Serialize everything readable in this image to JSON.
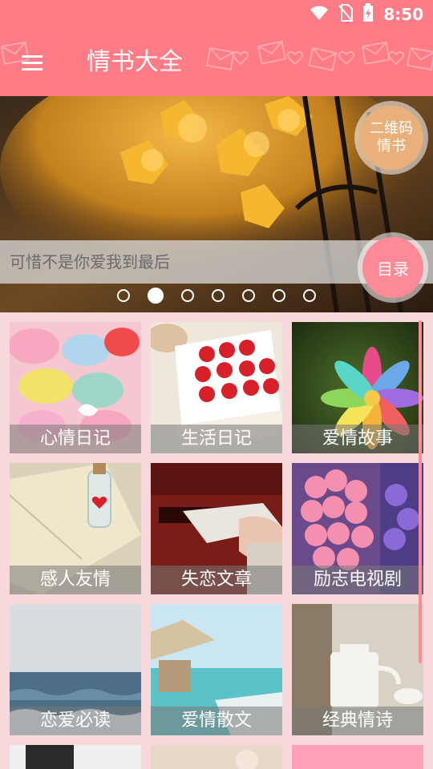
{
  "status_bar": {
    "time": "8:50",
    "icons": [
      "wifi-icon",
      "no-sim-icon",
      "battery-charging-icon"
    ]
  },
  "app_bar": {
    "title": "情书大全",
    "menu_icon": "menu-icon"
  },
  "banner": {
    "caption": "可惜不是你爱我到最后",
    "qr_button": "二维码\n情书",
    "qr_button_line1": "二维码",
    "qr_button_line2": "情书",
    "toc_button": "目录",
    "page_count": 7,
    "active_page": 2
  },
  "categories": [
    {
      "label": "心情日记"
    },
    {
      "label": "生活日记"
    },
    {
      "label": "爱情故事"
    },
    {
      "label": "感人友情"
    },
    {
      "label": "失恋文章"
    },
    {
      "label": "励志电视剧"
    },
    {
      "label": "恋爱必读"
    },
    {
      "label": "爱情散文"
    },
    {
      "label": "经典情诗"
    }
  ],
  "colors": {
    "primary": "#ff7b85",
    "accent_pink": "#ff8a97",
    "accent_orange": "#e9b07b",
    "background": "#f7d9dc"
  }
}
